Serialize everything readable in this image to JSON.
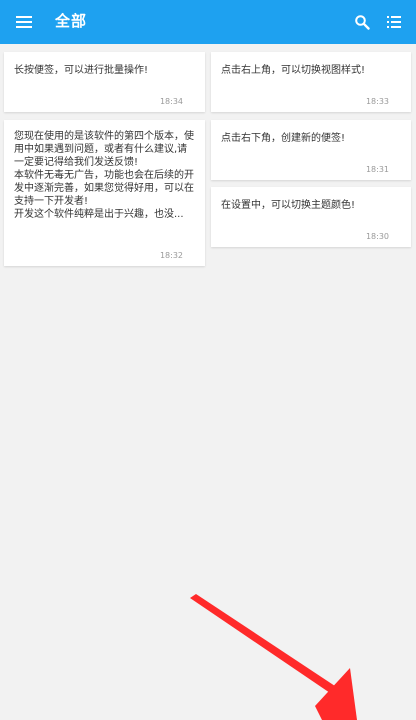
{
  "appbar": {
    "title": "全部",
    "menu_icon": "menu-icon",
    "search_icon": "search-icon",
    "view_icon": "list-view-icon",
    "color": "#1ea1f0"
  },
  "notes": [
    {
      "text": "长按便签，可以进行批量操作!",
      "time": "18:34"
    },
    {
      "text": "您现在使用的是该软件的第四个版本，使用中如果遇到问题，或者有什么建议,请一定要记得给我们发送反馈!\n本软件无毒无广告，功能也会在后续的开发中逐渐完善，如果您觉得好用，可以在支持一下开发者!\n开发这个软件纯粹是出于兴趣，也没...",
      "time": "18:32"
    },
    {
      "text": "点击右上角，可以切换视图样式!",
      "time": "18:33"
    },
    {
      "text": "点击右下角，创建新的便签!",
      "time": "18:31"
    },
    {
      "text": "在设置中，可以切换主题颜色!",
      "time": "18:30"
    }
  ],
  "annotation": {
    "type": "arrow",
    "color": "#ff2a2a"
  }
}
